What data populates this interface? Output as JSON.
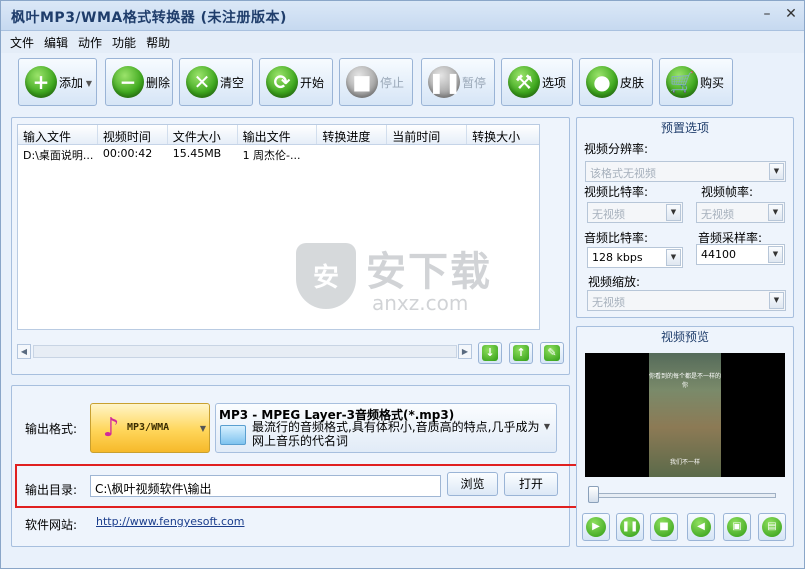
{
  "window": {
    "title": "枫叶MP3/WMA格式转换器  (未注册版本)",
    "minimize_glyph": "–",
    "close_glyph": "✕"
  },
  "menu": [
    "文件",
    "编辑",
    "动作",
    "功能",
    "帮助"
  ],
  "toolbar": {
    "add": "添加",
    "delete": "删除",
    "clear": "清空",
    "start": "开始",
    "stop": "停止",
    "pause": "暂停",
    "options": "选项",
    "skin": "皮肤",
    "buy": "购买"
  },
  "file_list": {
    "columns": [
      "输入文件",
      "视频时间",
      "文件大小",
      "输出文件",
      "转换进度",
      "当前时间",
      "转换大小"
    ],
    "rows": [
      [
        "D:\\桌面说明...",
        "00:00:42",
        "15.45MB",
        "1 周杰伦-...",
        "",
        "",
        ""
      ]
    ]
  },
  "output": {
    "format_label": "输出格式:",
    "format_button": "MP3/WMA",
    "format_title": "MP3 - MPEG Layer-3音频格式(*.mp3)",
    "format_desc": "最流行的音频格式,具有体积小,音质高的特点,几乎成为网上音乐的代名词",
    "dir_label": "输出目录:",
    "dir_value": "C:\\枫叶视频软件\\输出",
    "browse": "浏览",
    "open": "打开",
    "site_label": "软件网站:",
    "site_url": "http://www.fengyesoft.com"
  },
  "presets": {
    "title": "预置选项",
    "video_resolution_label": "视频分辨率:",
    "video_resolution_value": "该格式无视频",
    "video_bitrate_label": "视频比特率:",
    "video_bitrate_value": "无视频",
    "video_fps_label": "视频帧率:",
    "video_fps_value": "无视频",
    "audio_bitrate_label": "音频比特率:",
    "audio_bitrate_value": "128 kbps",
    "audio_samplerate_label": "音频采样率:",
    "audio_samplerate_value": "44100",
    "video_scale_label": "视频缩放:",
    "video_scale_value": "无视频"
  },
  "preview": {
    "title": "视频预览",
    "caption_top": "你看到的每个都是不一样的你",
    "caption_bottom": "我们不一样"
  },
  "watermark": {
    "shield": "安",
    "big": "安下载",
    "small": "anxz.com"
  }
}
